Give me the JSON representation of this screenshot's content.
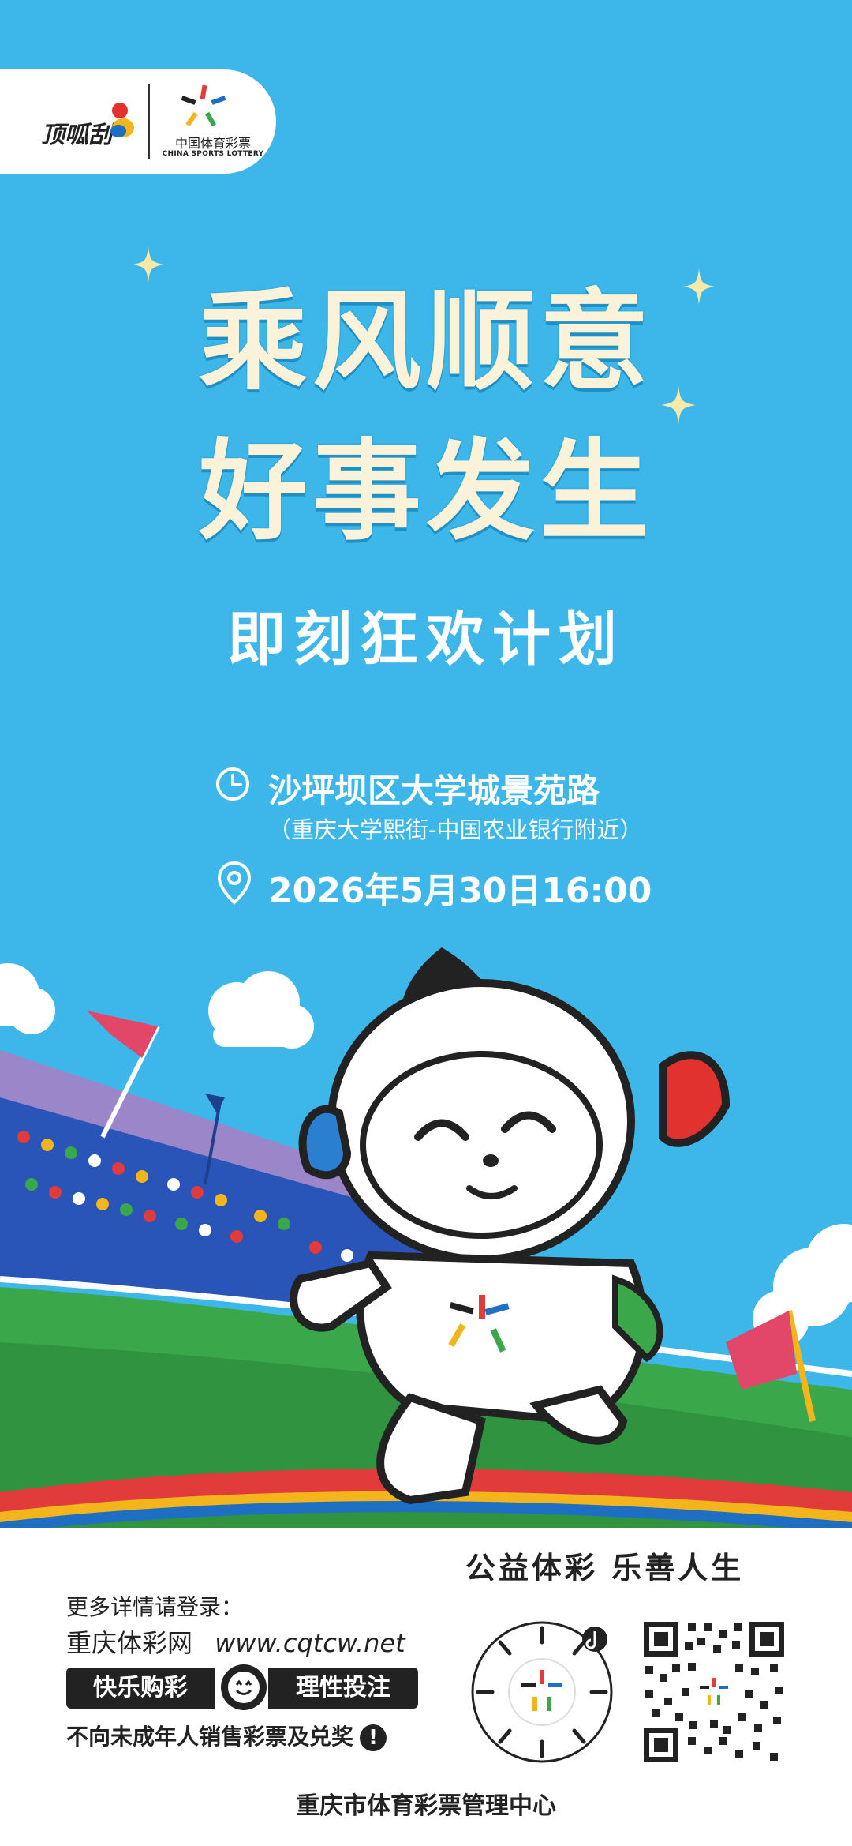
{
  "logos": {
    "brand_text": "顶呱刮",
    "lottery_cn": "中国体育彩票",
    "lottery_en": "CHINA SPORTS LOTTERY"
  },
  "headline": {
    "line1": "乘风顺意",
    "line2": "好事发生",
    "subtitle": "即刻狂欢计划"
  },
  "event": {
    "location": "沙坪坝区大学城景苑路",
    "location_detail": "（重庆大学熙街-中国农业银行附近）",
    "datetime": "2026年5月30日16:00"
  },
  "footer": {
    "slogan": "公益体彩 乐善人生",
    "more_info": "更多详情请登录：",
    "site_name": "重庆体彩网",
    "site_url": "www.cqtcw.net",
    "badge_left": "快乐购彩",
    "badge_right": "理性投注",
    "minor_notice": "不向未成年人销售彩票及兑奖",
    "organizer": "重庆市体育彩票管理中心"
  },
  "colors": {
    "sky": "#3db7e9",
    "title_cream": "#fbf3d9",
    "grass": "#3aa84a",
    "track_red": "#e23b3b",
    "ink": "#222222"
  }
}
